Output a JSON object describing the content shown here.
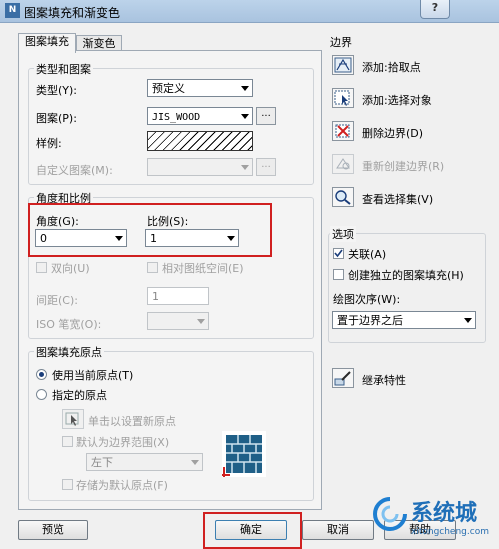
{
  "window": {
    "title": "图案填充和渐变色",
    "app_icon": "N",
    "help_label": "?"
  },
  "tabs": [
    {
      "label": "图案填充"
    },
    {
      "label": "渐变色"
    }
  ],
  "type_group": {
    "legend": "类型和图案",
    "type_label": "类型(Y):",
    "type_value": "预定义",
    "pattern_label": "图案(P):",
    "pattern_value": "JIS_WOOD",
    "swatch_label": "样例:",
    "custom_label": "自定义图案(M):",
    "dots": "..."
  },
  "angle_group": {
    "legend": "角度和比例",
    "angle_label": "角度(G):",
    "angle_value": "0",
    "scale_label": "比例(S):",
    "scale_value": "1",
    "double_label": "双向(U)",
    "relative_label": "相对图纸空间(E)",
    "spacing_label": "间距(C):",
    "spacing_value": "1",
    "iso_label": "ISO 笔宽(O):"
  },
  "origin_group": {
    "legend": "图案填充原点",
    "use_current": "使用当前原点(T)",
    "specified": "指定的原点",
    "click_set": "单击以设置新原点",
    "default_extent": "默认为边界范围(X)",
    "position_value": "左下",
    "store_default": "存储为默认原点(F)"
  },
  "boundary": {
    "legend": "边界",
    "add_pick": "添加:拾取点",
    "add_select": "添加:选择对象",
    "remove": "删除边界(D)",
    "recreate": "重新创建边界(R)",
    "view_set": "查看选择集(V)"
  },
  "options": {
    "legend": "选项",
    "associative": "关联(A)",
    "independent": "创建独立的图案填充(H)",
    "draw_order_label": "绘图次序(W):",
    "draw_order_value": "置于边界之后"
  },
  "inherit": "继承特性",
  "buttons": {
    "preview": "预览",
    "ok": "确定",
    "cancel": "取消",
    "help": "帮助"
  },
  "watermark": {
    "text": "系统城",
    "url": "xitongcheng.com"
  },
  "colors": {
    "highlight_red": "#d02020",
    "titlebar": "#bcd3ea"
  }
}
